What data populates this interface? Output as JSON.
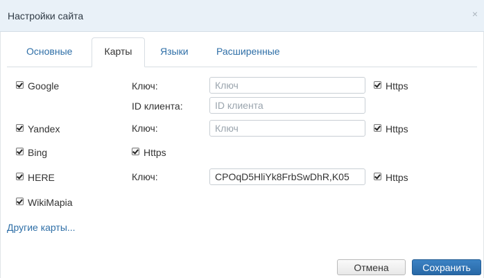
{
  "dialog": {
    "title": "Настройки сайта",
    "close_glyph": "×"
  },
  "tabs": [
    {
      "label": "Основные"
    },
    {
      "label": "Карты"
    },
    {
      "label": "Языки"
    },
    {
      "label": "Расширенные"
    }
  ],
  "maps": {
    "google": {
      "label": "Google",
      "key_label": "Ключ:",
      "key_placeholder": "Ключ",
      "client_label": "ID клиента:",
      "client_placeholder": "ID клиента",
      "https_label": "Https"
    },
    "yandex": {
      "label": "Yandex",
      "key_label": "Ключ:",
      "key_placeholder": "Ключ",
      "https_label": "Https"
    },
    "bing": {
      "label": "Bing",
      "https_label": "Https"
    },
    "here": {
      "label": "HERE",
      "key_label": "Ключ:",
      "key_value": "CPOqD5HliYk8FrbSwDhR,K05",
      "https_label": "Https"
    },
    "wikimapia": {
      "label": "WikiMapia"
    }
  },
  "other_maps_link": "Другие карты...",
  "footer": {
    "cancel_label": "Отмена",
    "save_label": "Сохранить"
  }
}
